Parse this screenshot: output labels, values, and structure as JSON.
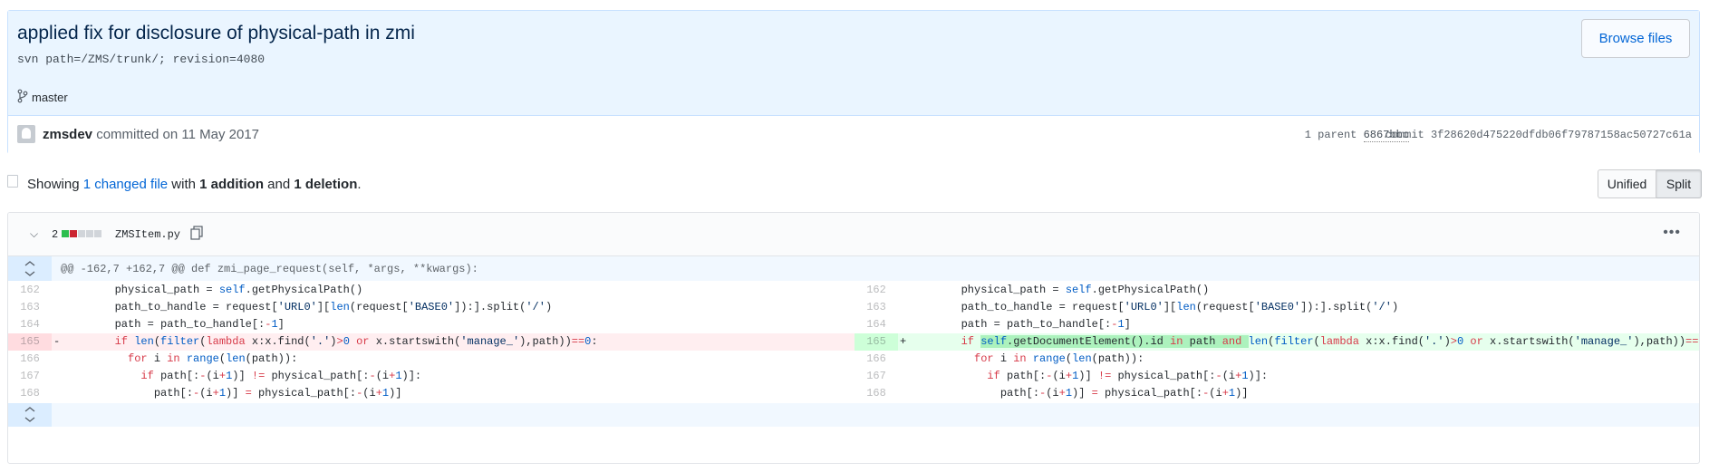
{
  "commit": {
    "title": "applied fix for disclosure of physical-path in zmi",
    "description": "svn path=/ZMS/trunk/; revision=4080",
    "browse_label": "Browse files",
    "branch": "master",
    "author": "zmsdev",
    "committed_text": "committed on 11 May 2017",
    "parent_label": "1 parent",
    "parent_sha": "6867bbc",
    "commit_label": "commit",
    "commit_sha": "3f28620d475220dfdb06f79787158ac50727c61a"
  },
  "toc": {
    "showing": "Showing",
    "files_link": "1 changed file",
    "with": "with",
    "additions": "1 addition",
    "and": "and",
    "deletions": "1 deletion",
    "period": "."
  },
  "view": {
    "unified_label": "Unified",
    "split_label": "Split",
    "selected": "Split"
  },
  "file": {
    "changes": "2",
    "name": "ZMSItem.py",
    "hunk_header": "@@ -162,7 +162,7 @@ def zmi_page_request(self, *args, **kwargs):",
    "colors": {
      "addition": "#2cbe4e",
      "deletion": "#cb2431",
      "neutral": "#d1d5da"
    },
    "left_lines": [
      {
        "num": "162"
      },
      {
        "num": "163"
      },
      {
        "num": "164"
      },
      {
        "num": "165",
        "marker": "-"
      },
      {
        "num": "166"
      },
      {
        "num": "167"
      },
      {
        "num": "168"
      }
    ],
    "right_lines": [
      {
        "num": "162"
      },
      {
        "num": "163"
      },
      {
        "num": "164"
      },
      {
        "num": "165",
        "marker": "+"
      },
      {
        "num": "166"
      },
      {
        "num": "167"
      },
      {
        "num": "168"
      }
    ]
  },
  "icons": [
    "branch-icon",
    "avatar",
    "toc-icon",
    "chevron-down-icon",
    "copy-icon",
    "more-icon",
    "expand-up-icon",
    "expand-down-icon"
  ]
}
